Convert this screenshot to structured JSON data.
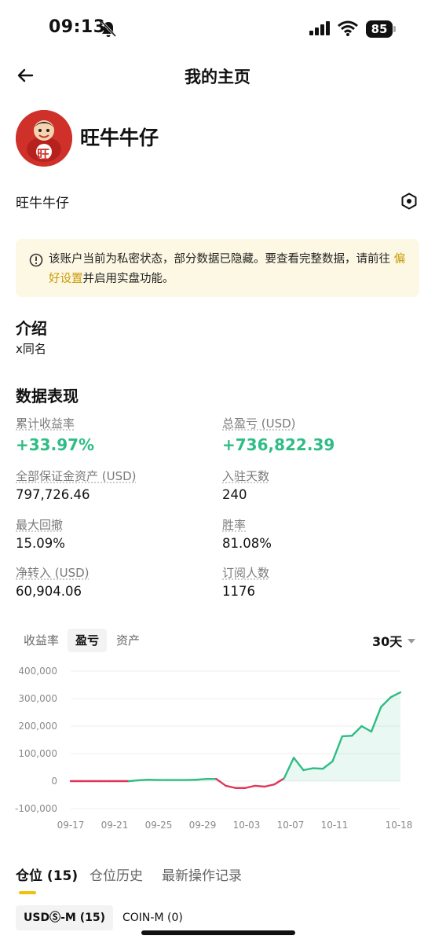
{
  "status": {
    "time": "09:13",
    "battery": "85"
  },
  "nav": {
    "title": "我的主页"
  },
  "profile": {
    "name": "旺牛牛仔",
    "nickname": "旺牛牛仔",
    "avatar_glyph": "旺"
  },
  "notice": {
    "text_before": "该账户当前为私密状态，部分数据已隐藏。要查看完整数据，请前往 ",
    "link": "偏好设置",
    "text_after": "并启用实盘功能。"
  },
  "intro": {
    "title": "介绍",
    "bio": "x同名"
  },
  "performance": {
    "title": "数据表现",
    "metrics": [
      {
        "label": "累计收益率",
        "value": "+33.97%"
      },
      {
        "label": "总盈亏 (USD)",
        "value": "+736,822.39"
      },
      {
        "label": "全部保证金资产 (USD)",
        "value": "797,726.46"
      },
      {
        "label": "入驻天数",
        "value": "240"
      },
      {
        "label": "最大回撤",
        "value": "15.09%"
      },
      {
        "label": "胜率",
        "value": "81.08%"
      },
      {
        "label": "净转入 (USD)",
        "value": "60,904.06"
      },
      {
        "label": "订阅人数",
        "value": "1176"
      }
    ]
  },
  "chart_tabs": [
    "收益率",
    "盈亏",
    "资产"
  ],
  "chart_range": "30天",
  "colors": {
    "positive": "#2ebd85",
    "negative": "#e0365a",
    "accent": "#f0c20a"
  },
  "chart_data": {
    "type": "area",
    "title": "",
    "xlabel": "",
    "ylabel": "",
    "ylim": [
      -100000,
      400000
    ],
    "y_ticks": [
      "400,000",
      "300,000",
      "200,000",
      "100,000",
      "0",
      "-100,000"
    ],
    "x_ticks": [
      "09-17",
      "09-21",
      "09-25",
      "09-29",
      "10-03",
      "10-07",
      "10-11",
      "10-18"
    ],
    "grid": true,
    "series": [
      {
        "values": [
          0,
          0,
          0,
          0,
          0,
          0,
          0,
          3000,
          5000,
          4000,
          4000,
          4000,
          4000,
          5000,
          8000,
          8000,
          -17000,
          -25000,
          -25000,
          -17000,
          -20000,
          -12000,
          10000,
          85000,
          40000,
          47000,
          45000,
          72000,
          163000,
          165000,
          200000,
          180000,
          270000,
          305000,
          323000
        ]
      }
    ]
  },
  "bottom_tabs": [
    "仓位 (15)",
    "仓位历史",
    "最新操作记录"
  ],
  "sub_tabs": [
    "USDⓈ-M (15)",
    "COIN-M (0)"
  ]
}
